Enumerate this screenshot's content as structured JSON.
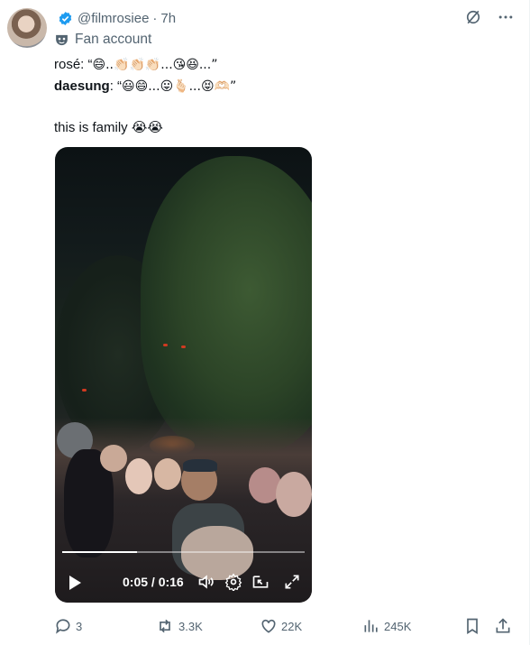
{
  "tweet": {
    "handle": "@filmrosiee",
    "separator": "·",
    "time": "7h",
    "label": "Fan account",
    "line1_prefix": "rosé: “",
    "line1_emojis": "😄..👏🏻👏🏻👏🏻...😘😆...”",
    "line2_name": "daesung",
    "line2_colon": ": “",
    "line2_emojis": "😃😄...😛🫰🏻...😝🫶🏻”",
    "line3": "this is family 😭😭"
  },
  "video": {
    "time_display": "0:05 / 0:16",
    "progress_fraction": 0.31
  },
  "actions": {
    "replies": "3",
    "reposts": "3.3K",
    "likes": "22K",
    "views": "245K"
  },
  "icons": [
    "verified-badge-icon",
    "grok-icon",
    "more-icon",
    "fan-mask-icon",
    "play-icon",
    "volume-icon",
    "settings-icon",
    "pip-icon",
    "fullscreen-icon",
    "reply-icon",
    "repost-icon",
    "like-icon",
    "views-icon",
    "bookmark-icon",
    "share-icon"
  ],
  "colors": {
    "accent": "#1d9bf0",
    "muted": "#536471",
    "text": "#0f1419"
  }
}
